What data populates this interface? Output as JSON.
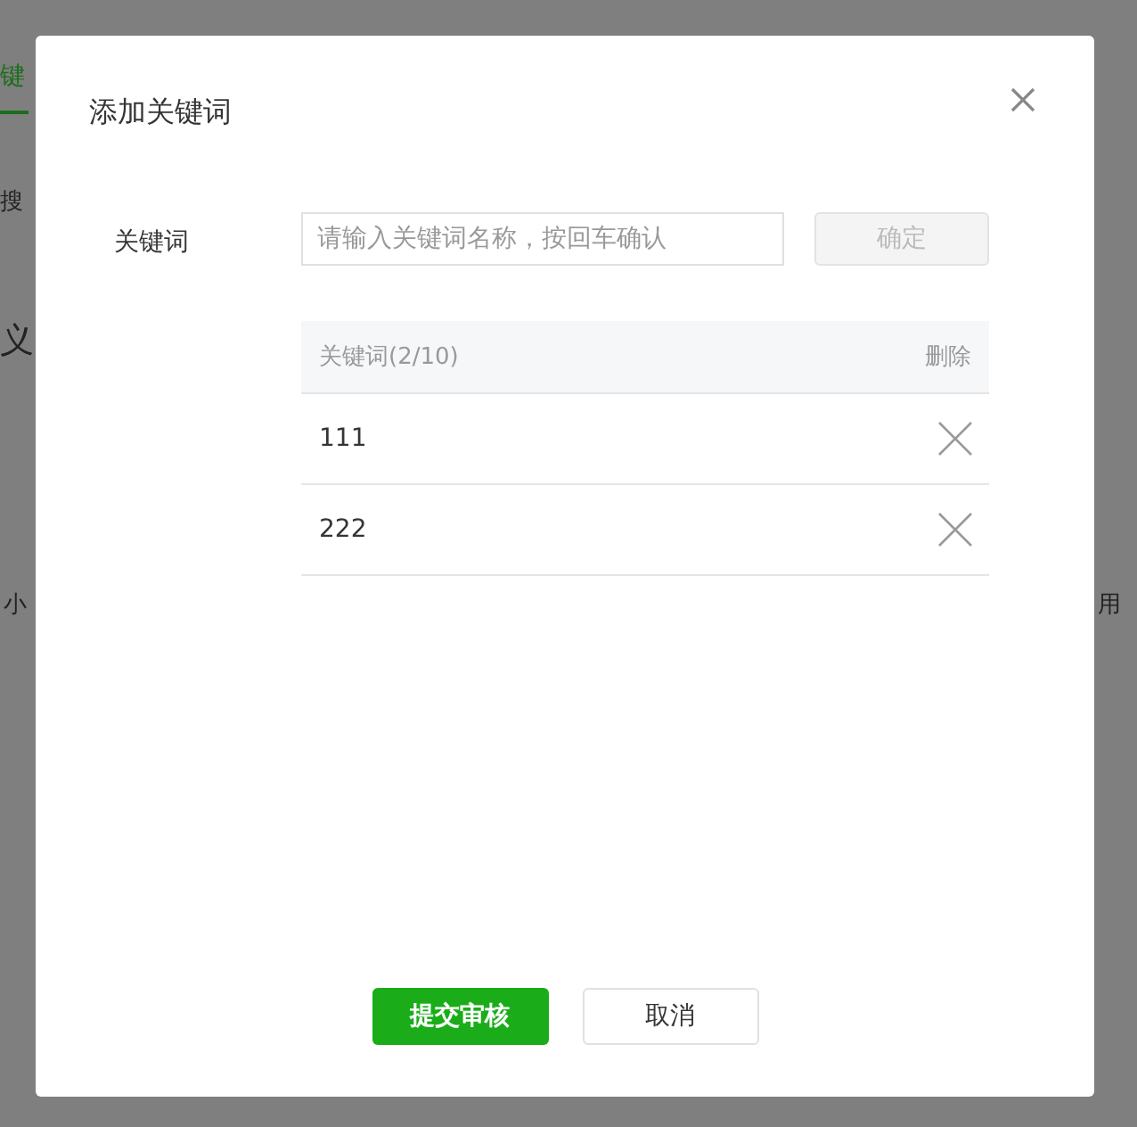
{
  "backdrop": {
    "tab": {
      "label": "键",
      "selected": true
    },
    "fragments": [
      "搜",
      "义",
      "小",
      "用"
    ]
  },
  "dialog": {
    "title": "添加关键词",
    "form": {
      "label": "关键词",
      "input": {
        "placeholder": "请输入关键词名称，按回车确认"
      },
      "confirm_button": {
        "label": "确定",
        "disabled": true
      }
    },
    "table": {
      "columns": [
        "关键词(2/10)",
        "删除"
      ],
      "rows": [
        {
          "keyword": "111"
        },
        {
          "keyword": "222"
        }
      ]
    },
    "buttons": [
      {
        "label": "提交审核",
        "kind": "primary"
      },
      {
        "label": "取消",
        "kind": "default"
      }
    ]
  }
}
